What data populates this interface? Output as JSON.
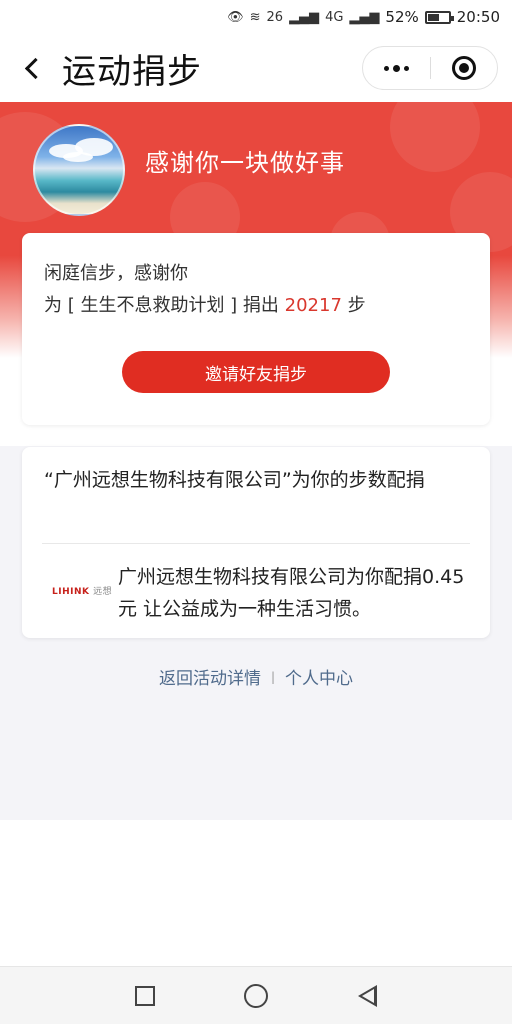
{
  "status_bar": {
    "network1": "26",
    "network2": "4G",
    "battery": "52%",
    "time": "20:50"
  },
  "nav": {
    "title": "运动捐步"
  },
  "hero": {
    "thanks": "感谢你一块做好事"
  },
  "donation_card": {
    "donor": "闲庭信步，感谢你",
    "project_prefix": "为 [ 生生不息救助计划 ] 捐出 ",
    "steps": "20217",
    "steps_unit": " 步",
    "invite_button": "邀请好友捐步"
  },
  "sponsor_card": {
    "heading": "“广州远想生物科技有限公司”为你的步数配捐",
    "logo_text": "LIHINK",
    "logo_sub": "远想",
    "description": "广州远想生物科技有限公司为你配捐0.45 元 让公益成为一种生活习惯。"
  },
  "footer": {
    "back_link": "返回活动详情",
    "separator": "|",
    "personal_center": "个人中心"
  },
  "colors": {
    "accent_red": "#e02d22",
    "hero_red": "#e8483e",
    "link_blue": "#506b8c"
  }
}
